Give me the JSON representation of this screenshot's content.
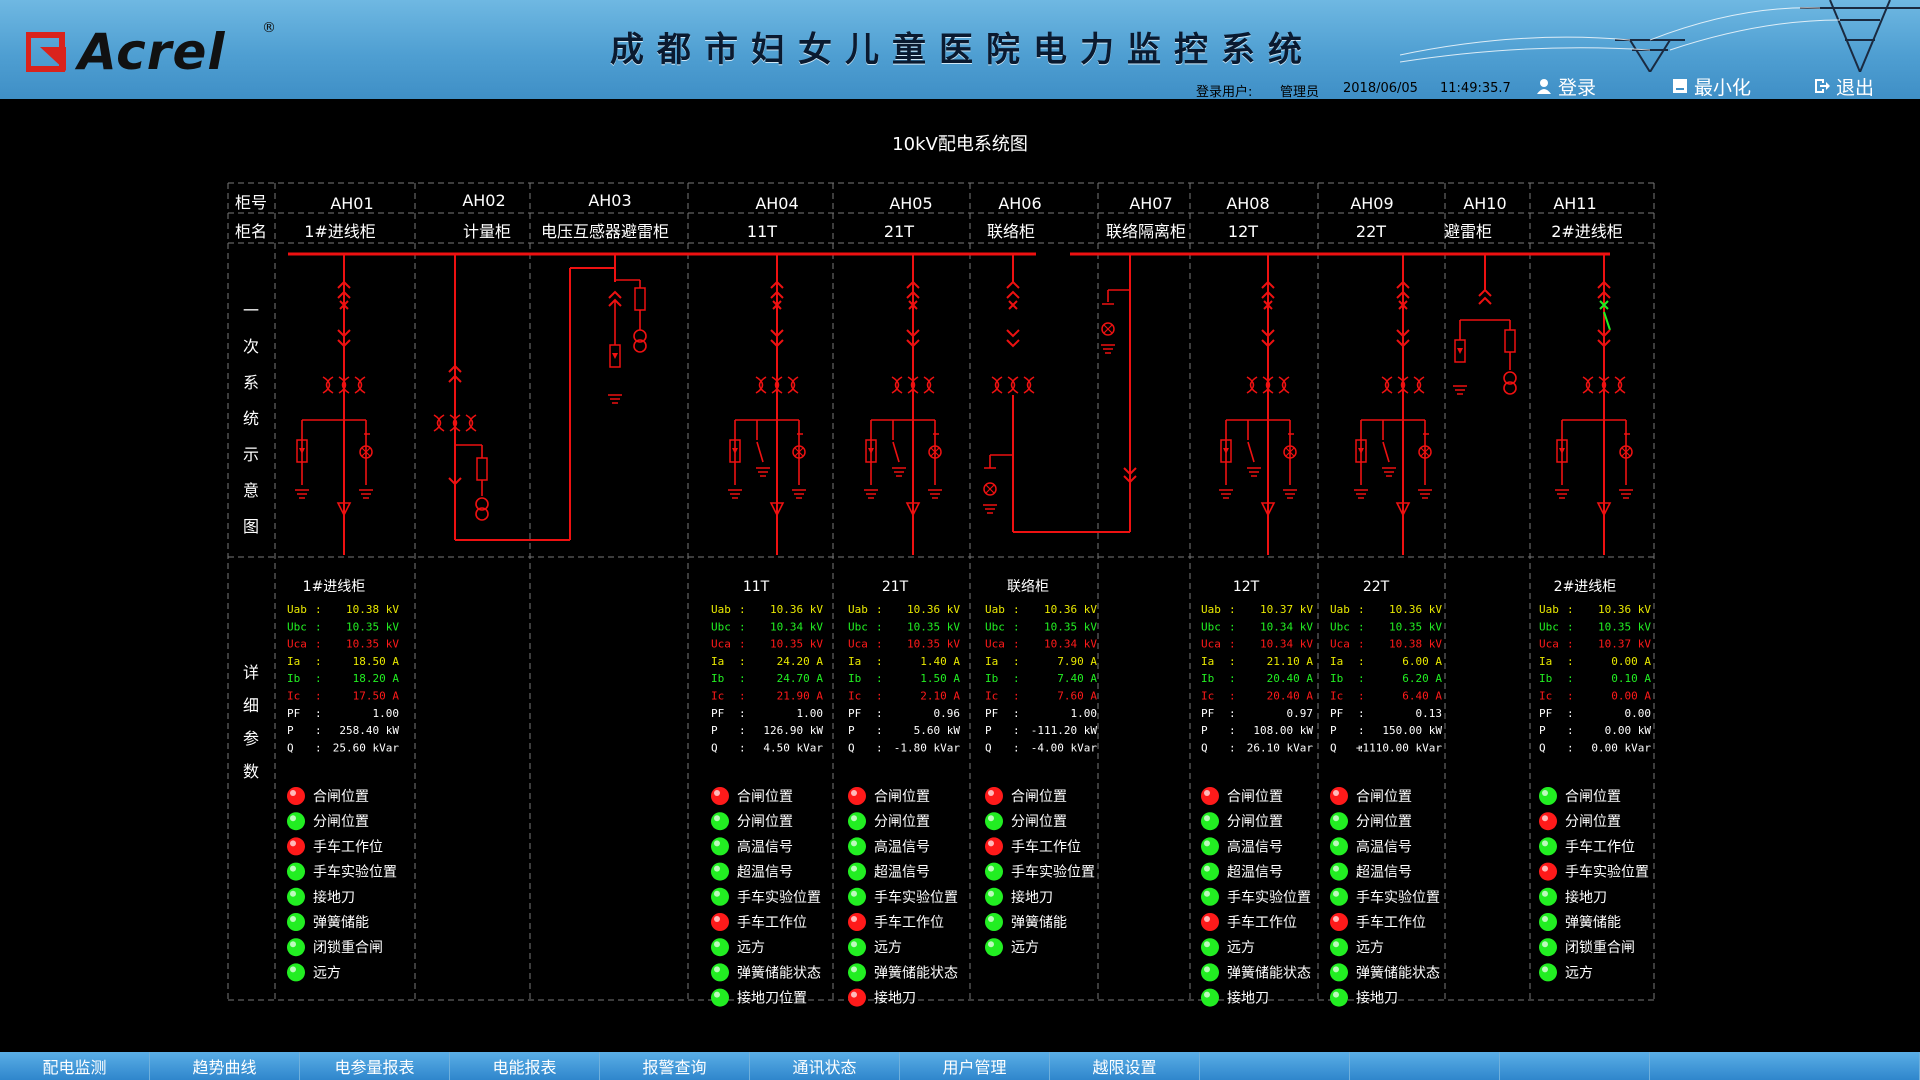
{
  "header": {
    "logo_text": "Acrel",
    "logo_reg": "®",
    "title": "成都市妇女儿童医院电力监控系统",
    "user_label": "登录用户:",
    "user_name": "管理员",
    "date": "2018/06/05",
    "time": "11:49:35.7",
    "login": "登录",
    "minimize": "最小化",
    "exit": "退出"
  },
  "diagram": {
    "title": "10kV配电系统图",
    "row_label_no": "柜号",
    "row_label_name": "柜名",
    "row_label_primary": [
      "一",
      "次",
      "系",
      "统",
      "示",
      "意",
      "图"
    ],
    "row_label_detail": [
      "详",
      "细",
      "参",
      "数"
    ]
  },
  "cabinets": [
    {
      "no": "AH01",
      "name": "1#进线柜"
    },
    {
      "no": "AH02",
      "name": "计量柜"
    },
    {
      "no": "AH03",
      "name": "电压互感器避雷柜"
    },
    {
      "no": "AH04",
      "name": "11T"
    },
    {
      "no": "AH05",
      "name": "21T"
    },
    {
      "no": "AH06",
      "name": "联络柜"
    },
    {
      "no": "AH07",
      "name": "联络隔离柜"
    },
    {
      "no": "AH08",
      "name": "12T"
    },
    {
      "no": "AH09",
      "name": "22T"
    },
    {
      "no": "AH10",
      "name": "避雷柜"
    },
    {
      "no": "AH11",
      "name": "2#进线柜"
    }
  ],
  "details": [
    {
      "title": "1#进线柜",
      "Uab": "10.38 kV",
      "Ubc": "10.35 kV",
      "Uca": "10.35 kV",
      "Ia": "18.50 A",
      "Ib": "18.20 A",
      "Ic": "17.50 A",
      "PF": "1.00",
      "P": "258.40 kW",
      "Q": "25.60 kVar",
      "status": [
        {
          "label": "合闸位置",
          "color": "red"
        },
        {
          "label": "分闸位置",
          "color": "green"
        },
        {
          "label": "手车工作位",
          "color": "red"
        },
        {
          "label": "手车实验位置",
          "color": "green"
        },
        {
          "label": "接地刀",
          "color": "green"
        },
        {
          "label": "弹簧储能",
          "color": "green"
        },
        {
          "label": "闭锁重合闸",
          "color": "green"
        },
        {
          "label": "远方",
          "color": "green"
        }
      ]
    },
    {
      "title": "11T",
      "Uab": "10.36 kV",
      "Ubc": "10.34 kV",
      "Uca": "10.35 kV",
      "Ia": "24.20 A",
      "Ib": "24.70 A",
      "Ic": "21.90 A",
      "PF": "1.00",
      "P": "126.90 kW",
      "Q": "4.50 kVar",
      "status": [
        {
          "label": "合闸位置",
          "color": "red"
        },
        {
          "label": "分闸位置",
          "color": "green"
        },
        {
          "label": "高温信号",
          "color": "green"
        },
        {
          "label": "超温信号",
          "color": "green"
        },
        {
          "label": "手车实验位置",
          "color": "green"
        },
        {
          "label": "手车工作位",
          "color": "red"
        },
        {
          "label": "远方",
          "color": "green"
        },
        {
          "label": "弹簧储能状态",
          "color": "green"
        },
        {
          "label": "接地刀位置",
          "color": "green"
        }
      ]
    },
    {
      "title": "21T",
      "Uab": "10.36 kV",
      "Ubc": "10.35 kV",
      "Uca": "10.35 kV",
      "Ia": "1.40 A",
      "Ib": "1.50 A",
      "Ic": "2.10 A",
      "PF": "0.96",
      "P": "5.60 kW",
      "Q": "-1.80 kVar",
      "status": [
        {
          "label": "合闸位置",
          "color": "red"
        },
        {
          "label": "分闸位置",
          "color": "green"
        },
        {
          "label": "高温信号",
          "color": "green"
        },
        {
          "label": "超温信号",
          "color": "green"
        },
        {
          "label": "手车实验位置",
          "color": "green"
        },
        {
          "label": "手车工作位",
          "color": "red"
        },
        {
          "label": "远方",
          "color": "green"
        },
        {
          "label": "弹簧储能状态",
          "color": "green"
        },
        {
          "label": "接地刀",
          "color": "red"
        }
      ]
    },
    {
      "title": "联络柜",
      "Uab": "10.36 kV",
      "Ubc": "10.35 kV",
      "Uca": "10.34 kV",
      "Ia": "7.90 A",
      "Ib": "7.40 A",
      "Ic": "7.60 A",
      "PF": "1.00",
      "P": "-111.20 kW",
      "Q": "-4.00 kVar",
      "status": [
        {
          "label": "合闸位置",
          "color": "red"
        },
        {
          "label": "分闸位置",
          "color": "green"
        },
        {
          "label": "手车工作位",
          "color": "red"
        },
        {
          "label": "手车实验位置",
          "color": "green"
        },
        {
          "label": "接地刀",
          "color": "green"
        },
        {
          "label": "弹簧储能",
          "color": "green"
        },
        {
          "label": "远方",
          "color": "green"
        }
      ]
    },
    {
      "title": "12T",
      "Uab": "10.37 kV",
      "Ubc": "10.34 kV",
      "Uca": "10.34 kV",
      "Ia": "21.10 A",
      "Ib": "20.40 A",
      "Ic": "20.40 A",
      "PF": "0.97",
      "P": "108.00 kW",
      "Q": "26.10 kVar",
      "status": [
        {
          "label": "合闸位置",
          "color": "red"
        },
        {
          "label": "分闸位置",
          "color": "green"
        },
        {
          "label": "高温信号",
          "color": "green"
        },
        {
          "label": "超温信号",
          "color": "green"
        },
        {
          "label": "手车实验位置",
          "color": "green"
        },
        {
          "label": "手车工作位",
          "color": "red"
        },
        {
          "label": "远方",
          "color": "green"
        },
        {
          "label": "弹簧储能状态",
          "color": "green"
        },
        {
          "label": "接地刀",
          "color": "green"
        }
      ]
    },
    {
      "title": "22T",
      "Uab": "10.36 kV",
      "Ubc": "10.35 kV",
      "Uca": "10.38 kV",
      "Ia": "6.00 A",
      "Ib": "6.20 A",
      "Ic": "6.40 A",
      "PF": "0.13",
      "P": "150.00 kW",
      "Q": "+1110.00 kVar",
      "status": [
        {
          "label": "合闸位置",
          "color": "red"
        },
        {
          "label": "分闸位置",
          "color": "green"
        },
        {
          "label": "高温信号",
          "color": "green"
        },
        {
          "label": "超温信号",
          "color": "green"
        },
        {
          "label": "手车实验位置",
          "color": "green"
        },
        {
          "label": "手车工作位",
          "color": "red"
        },
        {
          "label": "远方",
          "color": "green"
        },
        {
          "label": "弹簧储能状态",
          "color": "green"
        },
        {
          "label": "接地刀",
          "color": "green"
        }
      ]
    },
    {
      "title": "2#进线柜",
      "Uab": "10.36 kV",
      "Ubc": "10.35 kV",
      "Uca": "10.37 kV",
      "Ia": "0.00 A",
      "Ib": "0.10 A",
      "Ic": "0.00 A",
      "PF": "0.00",
      "P": "0.00 kW",
      "Q": "0.00 kVar",
      "status": [
        {
          "label": "合闸位置",
          "color": "green"
        },
        {
          "label": "分闸位置",
          "color": "red"
        },
        {
          "label": "手车工作位",
          "color": "green"
        },
        {
          "label": "手车实验位置",
          "color": "red"
        },
        {
          "label": "接地刀",
          "color": "green"
        },
        {
          "label": "弹簧储能",
          "color": "green"
        },
        {
          "label": "闭锁重合闸",
          "color": "green"
        },
        {
          "label": "远方",
          "color": "green"
        }
      ]
    }
  ],
  "nav": [
    "配电监测",
    "趋势曲线",
    "电参量报表",
    "电能报表",
    "报警查询",
    "通讯状态",
    "用户管理",
    "越限设置"
  ],
  "colors": {
    "red": "#ff1a1a",
    "green": "#22ee22",
    "yellow": "#e8e800",
    "bus": "#ee1111"
  }
}
